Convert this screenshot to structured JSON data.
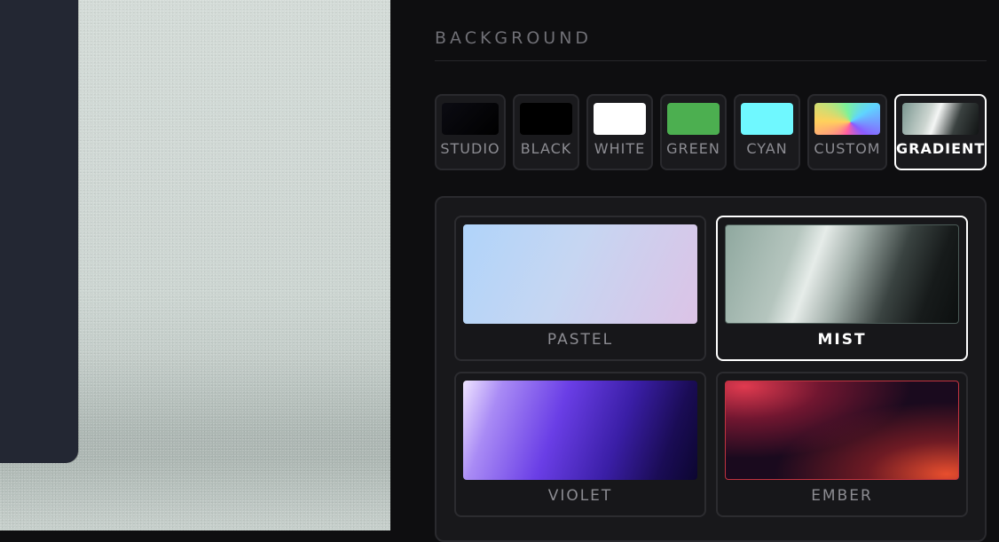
{
  "background_section": {
    "title": "BACKGROUND",
    "swatches": [
      {
        "label": "STUDIO",
        "color": "#050508",
        "selected": false
      },
      {
        "label": "BLACK",
        "color": "#000000",
        "selected": false
      },
      {
        "label": "WHITE",
        "color": "#ffffff",
        "selected": false
      },
      {
        "label": "GREEN",
        "color": "#4caf50",
        "selected": false
      },
      {
        "label": "CYAN",
        "color": "#6ff8ff",
        "selected": false
      },
      {
        "label": "CUSTOM",
        "color": "conic-rainbow",
        "selected": false
      },
      {
        "label": "GRADIENT",
        "color": "mist-gradient",
        "selected": true
      }
    ],
    "gradients": [
      {
        "label": "PASTEL",
        "selected": false
      },
      {
        "label": "MIST",
        "selected": true
      },
      {
        "label": "VIOLET",
        "selected": false
      },
      {
        "label": "EMBER",
        "selected": false
      }
    ]
  }
}
